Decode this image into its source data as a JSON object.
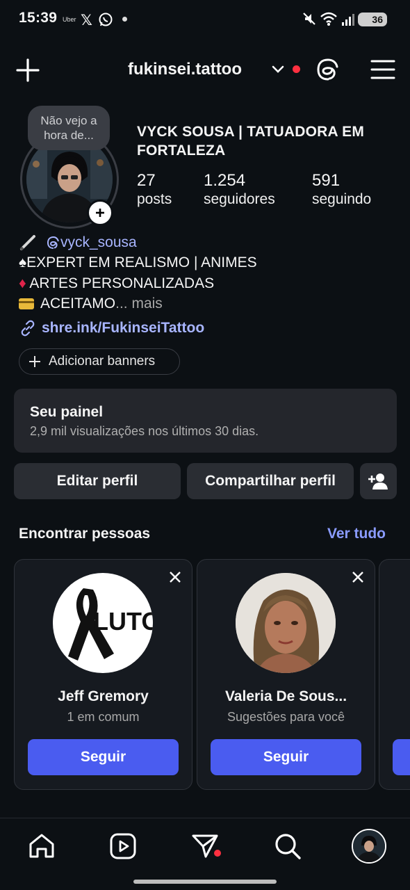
{
  "status_bar": {
    "time": "15:39",
    "uber_label": "Uber",
    "battery": "36"
  },
  "top_bar": {
    "username": "fukinsei.tattoo"
  },
  "profile": {
    "note": "Não vejo a hora de...",
    "display_name": "VYCK SOUSA | TATUADORA EM FORTALEZA",
    "stats": [
      {
        "value": "27",
        "label": "posts"
      },
      {
        "value": "1.254",
        "label": "seguidores"
      },
      {
        "value": "591",
        "label": "seguindo"
      }
    ],
    "threads_handle": "vyck_sousa",
    "bio_line1": "EXPERT EM REALISMO | ANIMES",
    "bio_line2": "ARTES PERSONALIZADAS",
    "bio_line3": "ACEITAMO",
    "more": "... mais",
    "link": "shre.ink/FukinseiTattoo",
    "add_banners": "Adicionar banners"
  },
  "dashboard": {
    "title": "Seu painel",
    "subtitle": "2,9 mil visualizações nos últimos 30 dias."
  },
  "actions": {
    "edit": "Editar perfil",
    "share": "Compartilhar perfil"
  },
  "discover": {
    "title": "Encontrar pessoas",
    "see_all": "Ver tudo",
    "people": [
      {
        "name": "Jeff Gremory",
        "context": "1 em comum",
        "button": "Seguir",
        "avatar_text": "LUTO"
      },
      {
        "name": "Valeria De Sous...",
        "context": "Sugestões para você",
        "button": "Seguir"
      }
    ]
  },
  "colors": {
    "background": "#0c1014",
    "accent": "#4a5cf0",
    "link": "#a8b5ff",
    "notification_dot": "#ff3040"
  }
}
